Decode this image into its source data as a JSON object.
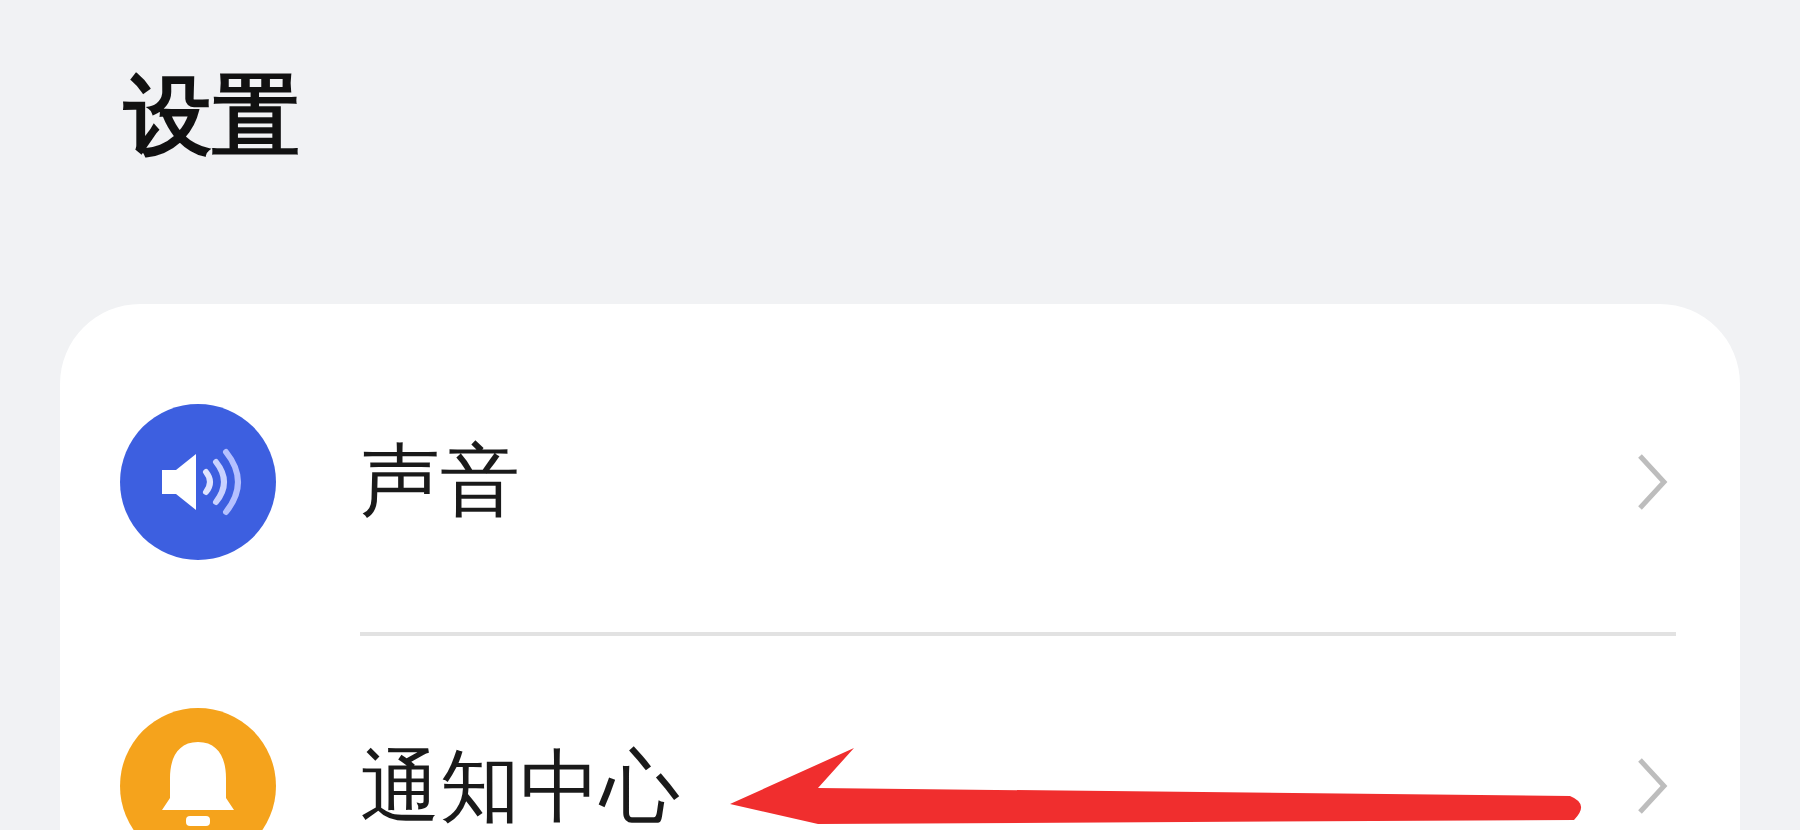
{
  "title": "设置",
  "items": [
    {
      "label": "声音",
      "kind": "speaker",
      "color": "#3d5fe0"
    },
    {
      "label": "通知中心",
      "kind": "bell",
      "color": "#f5a31c"
    }
  ],
  "annotation": {
    "kind": "arrow"
  }
}
